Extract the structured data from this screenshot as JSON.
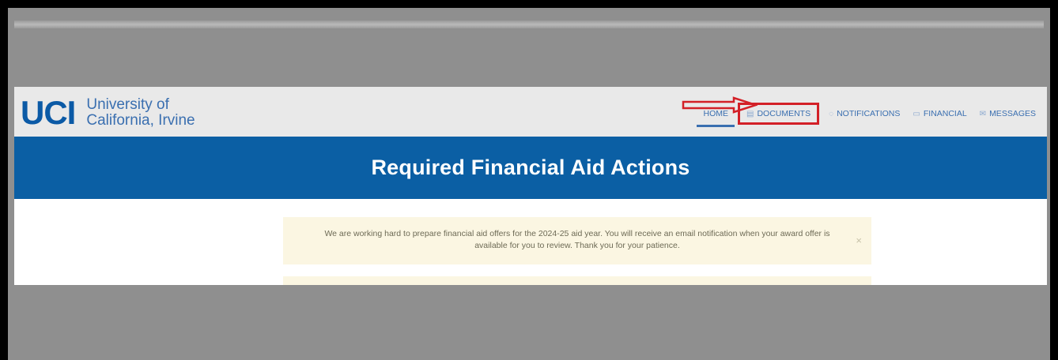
{
  "logo": {
    "mark": "UCI",
    "line1": "University of",
    "line2": "California, Irvine"
  },
  "nav": {
    "home": "HOME",
    "documents": "DOCUMENTS",
    "notifications": "NOTIFICATIONS",
    "financial": "FINANCIAL",
    "messages": "MESSAGES"
  },
  "banner": {
    "title": "Required Financial Aid Actions"
  },
  "alert": {
    "text": "We are working hard to prepare financial aid offers for the 2024-25 aid year. You will receive an email notification when your award offer is available for you to review. Thank you for your patience.",
    "close": "×"
  },
  "colors": {
    "brand_blue": "#0b5fa4",
    "annotation_red": "#d32027",
    "alert_bg": "#fbf6e2"
  }
}
